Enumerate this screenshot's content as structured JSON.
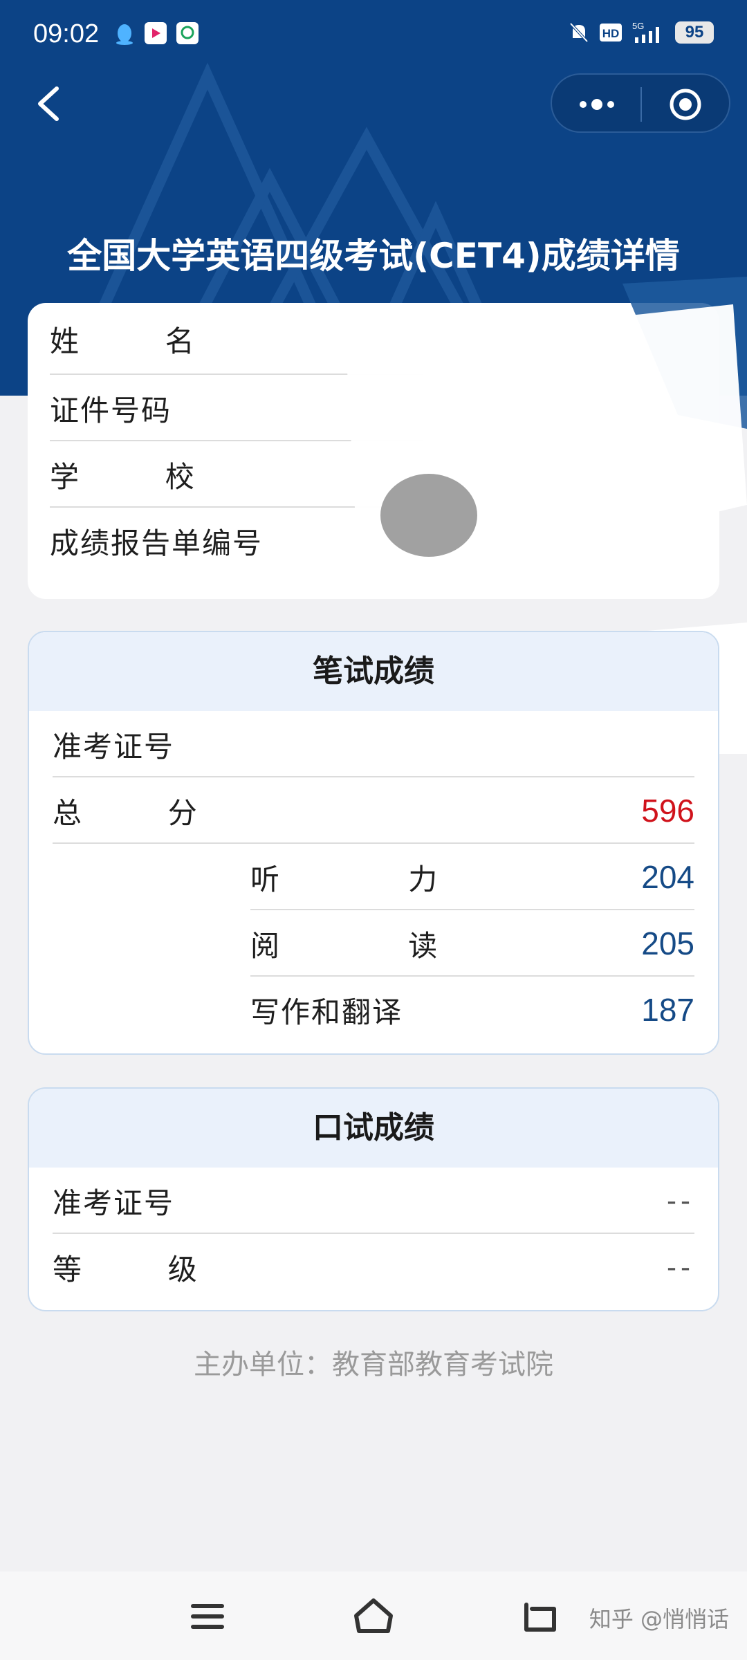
{
  "status_bar": {
    "time": "09:02",
    "battery": "95",
    "network": "5G"
  },
  "header": {
    "title": "全国大学英语四级考试(CET4)成绩详情",
    "back_icon": "chevron-left-icon",
    "more_icon": "more-dots-icon",
    "close_icon": "target-close-icon",
    "background_color": "#0c4386"
  },
  "info": {
    "rows": [
      {
        "label": "姓        名",
        "value": ""
      },
      {
        "label": "证件号码",
        "value": ""
      },
      {
        "label": "学        校",
        "value": ""
      },
      {
        "label": "成绩报告单编号",
        "value": ""
      }
    ]
  },
  "written": {
    "title": "笔试成绩",
    "ticket_label": "准考证号",
    "ticket_value": "",
    "total_label": "总        分",
    "total_value": "596",
    "listening_label": "听            力",
    "listening_value": "204",
    "reading_label": "阅            读",
    "reading_value": "205",
    "writing_label": "写作和翻译",
    "writing_value": "187"
  },
  "oral": {
    "title": "口试成绩",
    "ticket_label": "准考证号",
    "ticket_value": "--",
    "grade_label": "等        级",
    "grade_value": "--"
  },
  "footer": {
    "organizer": "主办单位：教育部教育考试院"
  },
  "nav": {
    "menu_icon": "menu-icon",
    "home_icon": "home-icon",
    "back_icon": "back-icon"
  },
  "watermark": "知乎 @悄悄话",
  "colors": {
    "brand": "#0c4386",
    "total_score": "#d0121b",
    "sub_score": "#154a86"
  }
}
